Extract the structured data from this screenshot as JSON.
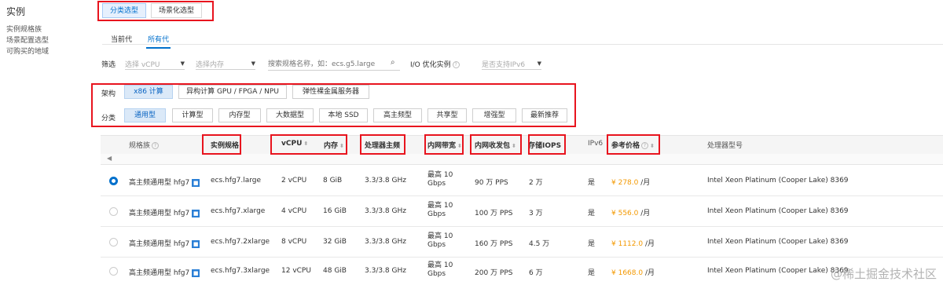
{
  "sidebar": {
    "title": "实例",
    "items": [
      "实例规格族",
      "场景配置选型",
      "可购买的地域"
    ]
  },
  "top_tabs": [
    "分类选型",
    "场景化选型"
  ],
  "gen_tabs": [
    "当前代",
    "所有代"
  ],
  "filters": {
    "label": "筛选",
    "vcpu_placeholder": "选择 vCPU",
    "memory_placeholder": "选择内存",
    "search_placeholder": "搜索规格名称，如：ecs.g5.large",
    "io_label": "I/O 优化实例",
    "ipv6_placeholder": "是否支持IPv6"
  },
  "arch": {
    "label": "架构",
    "chips": [
      "x86 计算",
      "异构计算 GPU / FPGA / NPU",
      "弹性裸金属服务器"
    ]
  },
  "category": {
    "label": "分类",
    "chips": [
      "通用型",
      "计算型",
      "内存型",
      "大数据型",
      "本地 SSD",
      "高主频型",
      "共享型",
      "增强型",
      "最新推荐"
    ]
  },
  "table": {
    "headers": {
      "family": "规格族",
      "spec": "实例规格",
      "vcpu": "vCPU",
      "memory": "内存",
      "freq": "处理器主频",
      "bandwidth": "内网带宽",
      "pps": "内网收发包",
      "iops": "存储IOPS",
      "ipv6": "IPv6",
      "price": "参考价格",
      "cpu_model": "处理器型号"
    },
    "rows": [
      {
        "family": "高主频通用型 hfg7",
        "spec": "ecs.hfg7.large",
        "vcpu": "2 vCPU",
        "memory": "8 GiB",
        "freq": "3.3/3.8 GHz",
        "bandwidth": "最高 10 Gbps",
        "pps": "90 万 PPS",
        "iops": "2 万",
        "ipv6": "是",
        "price": "¥ 278.0",
        "unit": "/月",
        "cpu_model": "Intel Xeon Platinum (Cooper Lake) 8369"
      },
      {
        "family": "高主频通用型 hfg7",
        "spec": "ecs.hfg7.xlarge",
        "vcpu": "4 vCPU",
        "memory": "16 GiB",
        "freq": "3.3/3.8 GHz",
        "bandwidth": "最高 10 Gbps",
        "pps": "100 万 PPS",
        "iops": "3 万",
        "ipv6": "是",
        "price": "¥ 556.0",
        "unit": "/月",
        "cpu_model": "Intel Xeon Platinum (Cooper Lake) 8369"
      },
      {
        "family": "高主频通用型 hfg7",
        "spec": "ecs.hfg7.2xlarge",
        "vcpu": "8 vCPU",
        "memory": "32 GiB",
        "freq": "3.3/3.8 GHz",
        "bandwidth": "最高 10 Gbps",
        "pps": "160 万 PPS",
        "iops": "4.5 万",
        "ipv6": "是",
        "price": "¥ 1112.0",
        "unit": "/月",
        "cpu_model": "Intel Xeon Platinum (Cooper Lake) 8369"
      },
      {
        "family": "高主频通用型 hfg7",
        "spec": "ecs.hfg7.3xlarge",
        "vcpu": "12 vCPU",
        "memory": "48 GiB",
        "freq": "3.3/3.8 GHz",
        "bandwidth": "最高 10 Gbps",
        "pps": "200 万 PPS",
        "iops": "6 万",
        "ipv6": "是",
        "price": "¥ 1668.0",
        "unit": "/月",
        "cpu_model": "Intel Xeon Platinum (Cooper Lake) 8369"
      }
    ]
  },
  "watermark": "@稀土掘金技术社区"
}
